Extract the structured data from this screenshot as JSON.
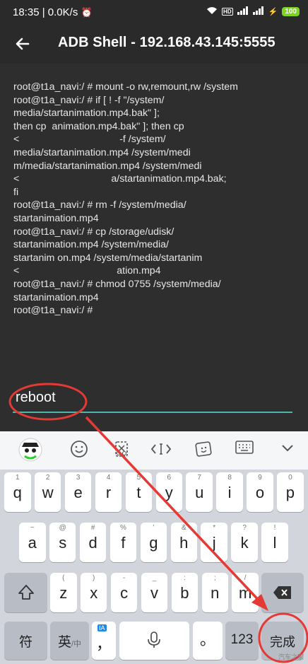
{
  "status_bar": {
    "time": "18:35",
    "speed": "0.0K/s",
    "battery": "100"
  },
  "app_bar": {
    "title": "ADB Shell - 192.168.43.145:5555"
  },
  "terminal": {
    "output": "root@t1a_navi:/ # mount -o rw,remount,rw /system\nroot@t1a_navi:/ # if [ ! -f \"/system/\nmedia/startanimation.mp4.bak\" ];\nthen cp  animation.mp4.bak\" ]; then cp\n<                                    -f /system/\nmedia/startanimation.mp4 /system/medi\nm/media/startanimation.mp4 /system/medi\n<                                 a/startanimation.mp4.bak;\nfi\nroot@t1a_navi:/ # rm -f /system/media/\nstartanimation.mp4\nroot@t1a_navi:/ # cp /storage/udisk/\nstartanimation.mp4 /system/media/\nstartanim on.mp4 /system/media/startanim\n<                                   ation.mp4\nroot@t1a_navi:/ # chmod 0755 /system/media/\nstartanimation.mp4\nroot@t1a_navi:/ #"
  },
  "command": {
    "value": "reboot"
  },
  "keyboard": {
    "row1": [
      {
        "hint": "1",
        "key": "q"
      },
      {
        "hint": "2",
        "key": "w"
      },
      {
        "hint": "3",
        "key": "e"
      },
      {
        "hint": "4",
        "key": "r"
      },
      {
        "hint": "5",
        "key": "t"
      },
      {
        "hint": "6",
        "key": "y"
      },
      {
        "hint": "7",
        "key": "u"
      },
      {
        "hint": "8",
        "key": "i"
      },
      {
        "hint": "9",
        "key": "o"
      },
      {
        "hint": "0",
        "key": "p"
      }
    ],
    "row2": [
      {
        "hint": "~",
        "key": "a"
      },
      {
        "hint": "@",
        "key": "s"
      },
      {
        "hint": "#",
        "key": "d"
      },
      {
        "hint": "%",
        "key": "f"
      },
      {
        "hint": "'",
        "key": "g"
      },
      {
        "hint": "&",
        "key": "h"
      },
      {
        "hint": "*",
        "key": "j"
      },
      {
        "hint": "?",
        "key": "k"
      },
      {
        "hint": "!",
        "key": "l"
      }
    ],
    "row3": [
      {
        "hint": "(",
        "key": "z"
      },
      {
        "hint": ")",
        "key": "x"
      },
      {
        "hint": "-",
        "key": "c"
      },
      {
        "hint": "_",
        "key": "v"
      },
      {
        "hint": ":",
        "key": "b"
      },
      {
        "hint": ";",
        "key": "n"
      },
      {
        "hint": "/",
        "key": "m"
      }
    ],
    "fu_label": "符",
    "ying_label": "英",
    "zhong_label": "/中",
    "ia_label": "IA",
    "comma_label": "，",
    "period_label": "。",
    "num_label": "123",
    "done_label": "完成"
  },
  "watermark": "汽车之家",
  "colors": {
    "accent_teal": "#4db6ac",
    "annotation_red": "#e53935"
  }
}
